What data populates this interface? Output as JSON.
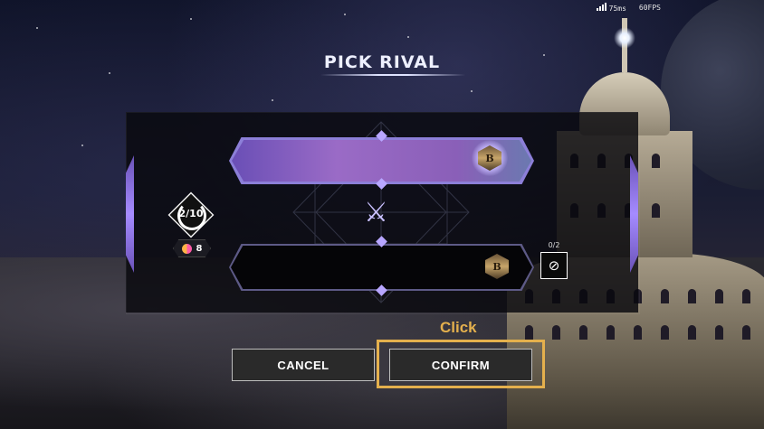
{
  "hud": {
    "ping": "75ms",
    "fps": "60FPS"
  },
  "title": "PICK RIVAL",
  "left_panel": {
    "attempts": "2/10",
    "tokens": "8"
  },
  "swap": {
    "count": "0/2"
  },
  "badges": {
    "top_letter": "B",
    "bottom_letter": "B"
  },
  "buttons": {
    "cancel": "CANCEL",
    "confirm": "CONFIRM"
  },
  "hint": {
    "label": "Click"
  },
  "colors": {
    "accent": "#a58bff",
    "highlight": "#e4b04d"
  }
}
